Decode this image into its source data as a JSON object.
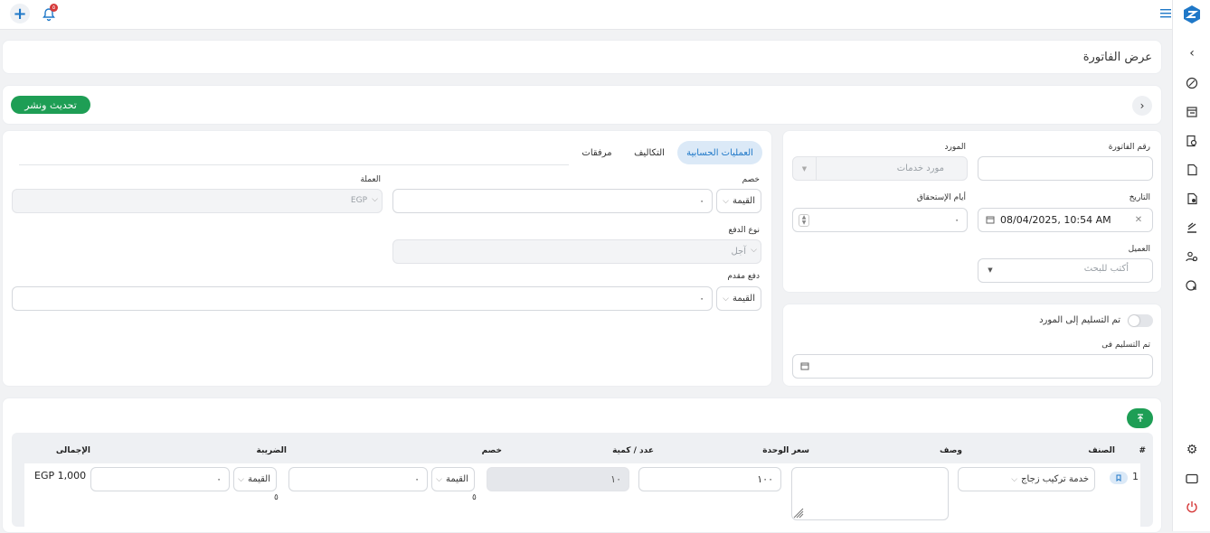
{
  "topbar": {
    "notification_count": "٥"
  },
  "page": {
    "title": "عرض الفاتورة"
  },
  "toolbar": {
    "update_publish_label": "تحديث ونشر"
  },
  "invoice_form": {
    "invoice_number_label": "رقم الفاتورة",
    "invoice_number_value": "",
    "supplier_label": "المورد",
    "supplier_value": "مورد خدمات",
    "date_label": "التاريخ",
    "date_value": "08/04/2025, 10:54 AM",
    "due_days_label": "أيام الإستحقاق",
    "due_days_value": "٠",
    "client_label": "العميل",
    "client_placeholder": "أكتب للبحث"
  },
  "delivery": {
    "delivered_toggle_label": "تم التسليم إلى المورد",
    "delivered_at_label": "تم التسليم فى"
  },
  "tabs": {
    "accounting": "العمليات الحسابية",
    "costs": "التكاليف",
    "attachments": "مرفقات"
  },
  "accounting": {
    "discount_label": "خصم",
    "discount_type": "القيمة",
    "discount_value": "٠",
    "currency_label": "العملة",
    "currency_value": "EGP",
    "payment_type_label": "نوع الدفع",
    "payment_type_value": "آجل",
    "down_payment_label": "دفع مقدم",
    "down_payment_type": "القيمة",
    "down_payment_value": "٠"
  },
  "items_table": {
    "headers": {
      "index": "#",
      "item": "الصنف",
      "description": "وصف",
      "unit_price": "سعر الوحدة",
      "quantity": "عدد / كمية",
      "discount": "خصم",
      "tax": "الضريبة",
      "total": "الإجمالى"
    },
    "rows": [
      {
        "index": "1",
        "item": "خدمة تركيب زجاج",
        "unit_price": "١٠٠",
        "quantity": "١٠",
        "discount_type": "القيمة",
        "discount_value": "٠",
        "discount_sub": "٥",
        "tax_type": "القيمة",
        "tax_value": "٠",
        "tax_sub": "٥",
        "total": "EGP 1,000"
      }
    ]
  },
  "colors": {
    "accent_green": "#1e9e55",
    "brand_blue": "#1f78c8",
    "tab_active_bg": "#dbe9f7",
    "power_red": "#d63b3b"
  }
}
